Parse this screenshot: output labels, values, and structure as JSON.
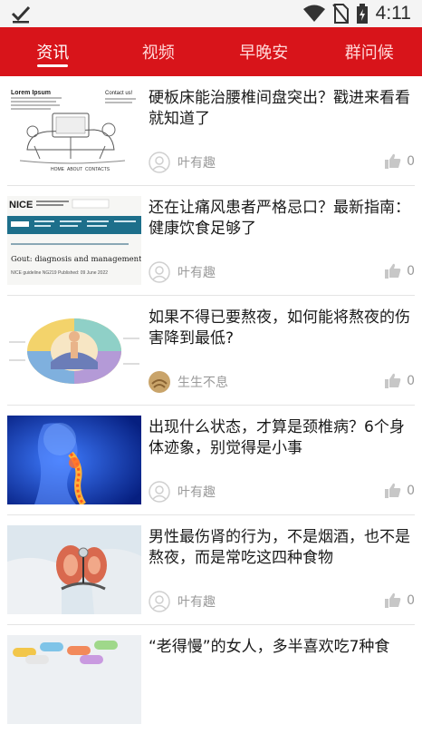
{
  "status_bar": {
    "time": "4:11"
  },
  "tabs": [
    {
      "label": "资讯",
      "active": true
    },
    {
      "label": "视频",
      "active": false
    },
    {
      "label": "早晚安",
      "active": false
    },
    {
      "label": "群问候",
      "active": false
    }
  ],
  "articles": [
    {
      "title": "硬板床能治腰椎间盘突出？戳进来看看就知道了",
      "author": "叶有趣",
      "likes": "0"
    },
    {
      "title": "还在让痛风患者严格忌口？最新指南：健康饮食足够了",
      "author": "叶有趣",
      "likes": "0"
    },
    {
      "title": "如果不得已要熬夜，如何能将熬夜的伤害降到最低?",
      "author": "生生不息",
      "likes": "0"
    },
    {
      "title": "出现什么状态，才算是颈椎病？6个身体迹象，别觉得是小事",
      "author": "叶有趣",
      "likes": "0"
    },
    {
      "title": "男性最伤肾的行为，不是烟酒，也不是熬夜，而是常吃这四种食物",
      "author": "叶有趣",
      "likes": "0"
    },
    {
      "title": "“老得慢”的女人，多半喜欢吃7种食"
    }
  ],
  "thumbnails": {
    "t1": {
      "heading": "Lorem Ipsum",
      "contact": "Contact us!",
      "nav": [
        "HOME",
        "ABOUT",
        "CONTACTS"
      ]
    },
    "t2": {
      "logo": "NICE",
      "title": "Gout: diagnosis and management",
      "sub": "NICE guideline NG219   Published: 09 June 2022"
    }
  },
  "colors": {
    "brand_red": "#d8141a",
    "text": "#1a1a1a",
    "meta": "#9a9a9a"
  }
}
